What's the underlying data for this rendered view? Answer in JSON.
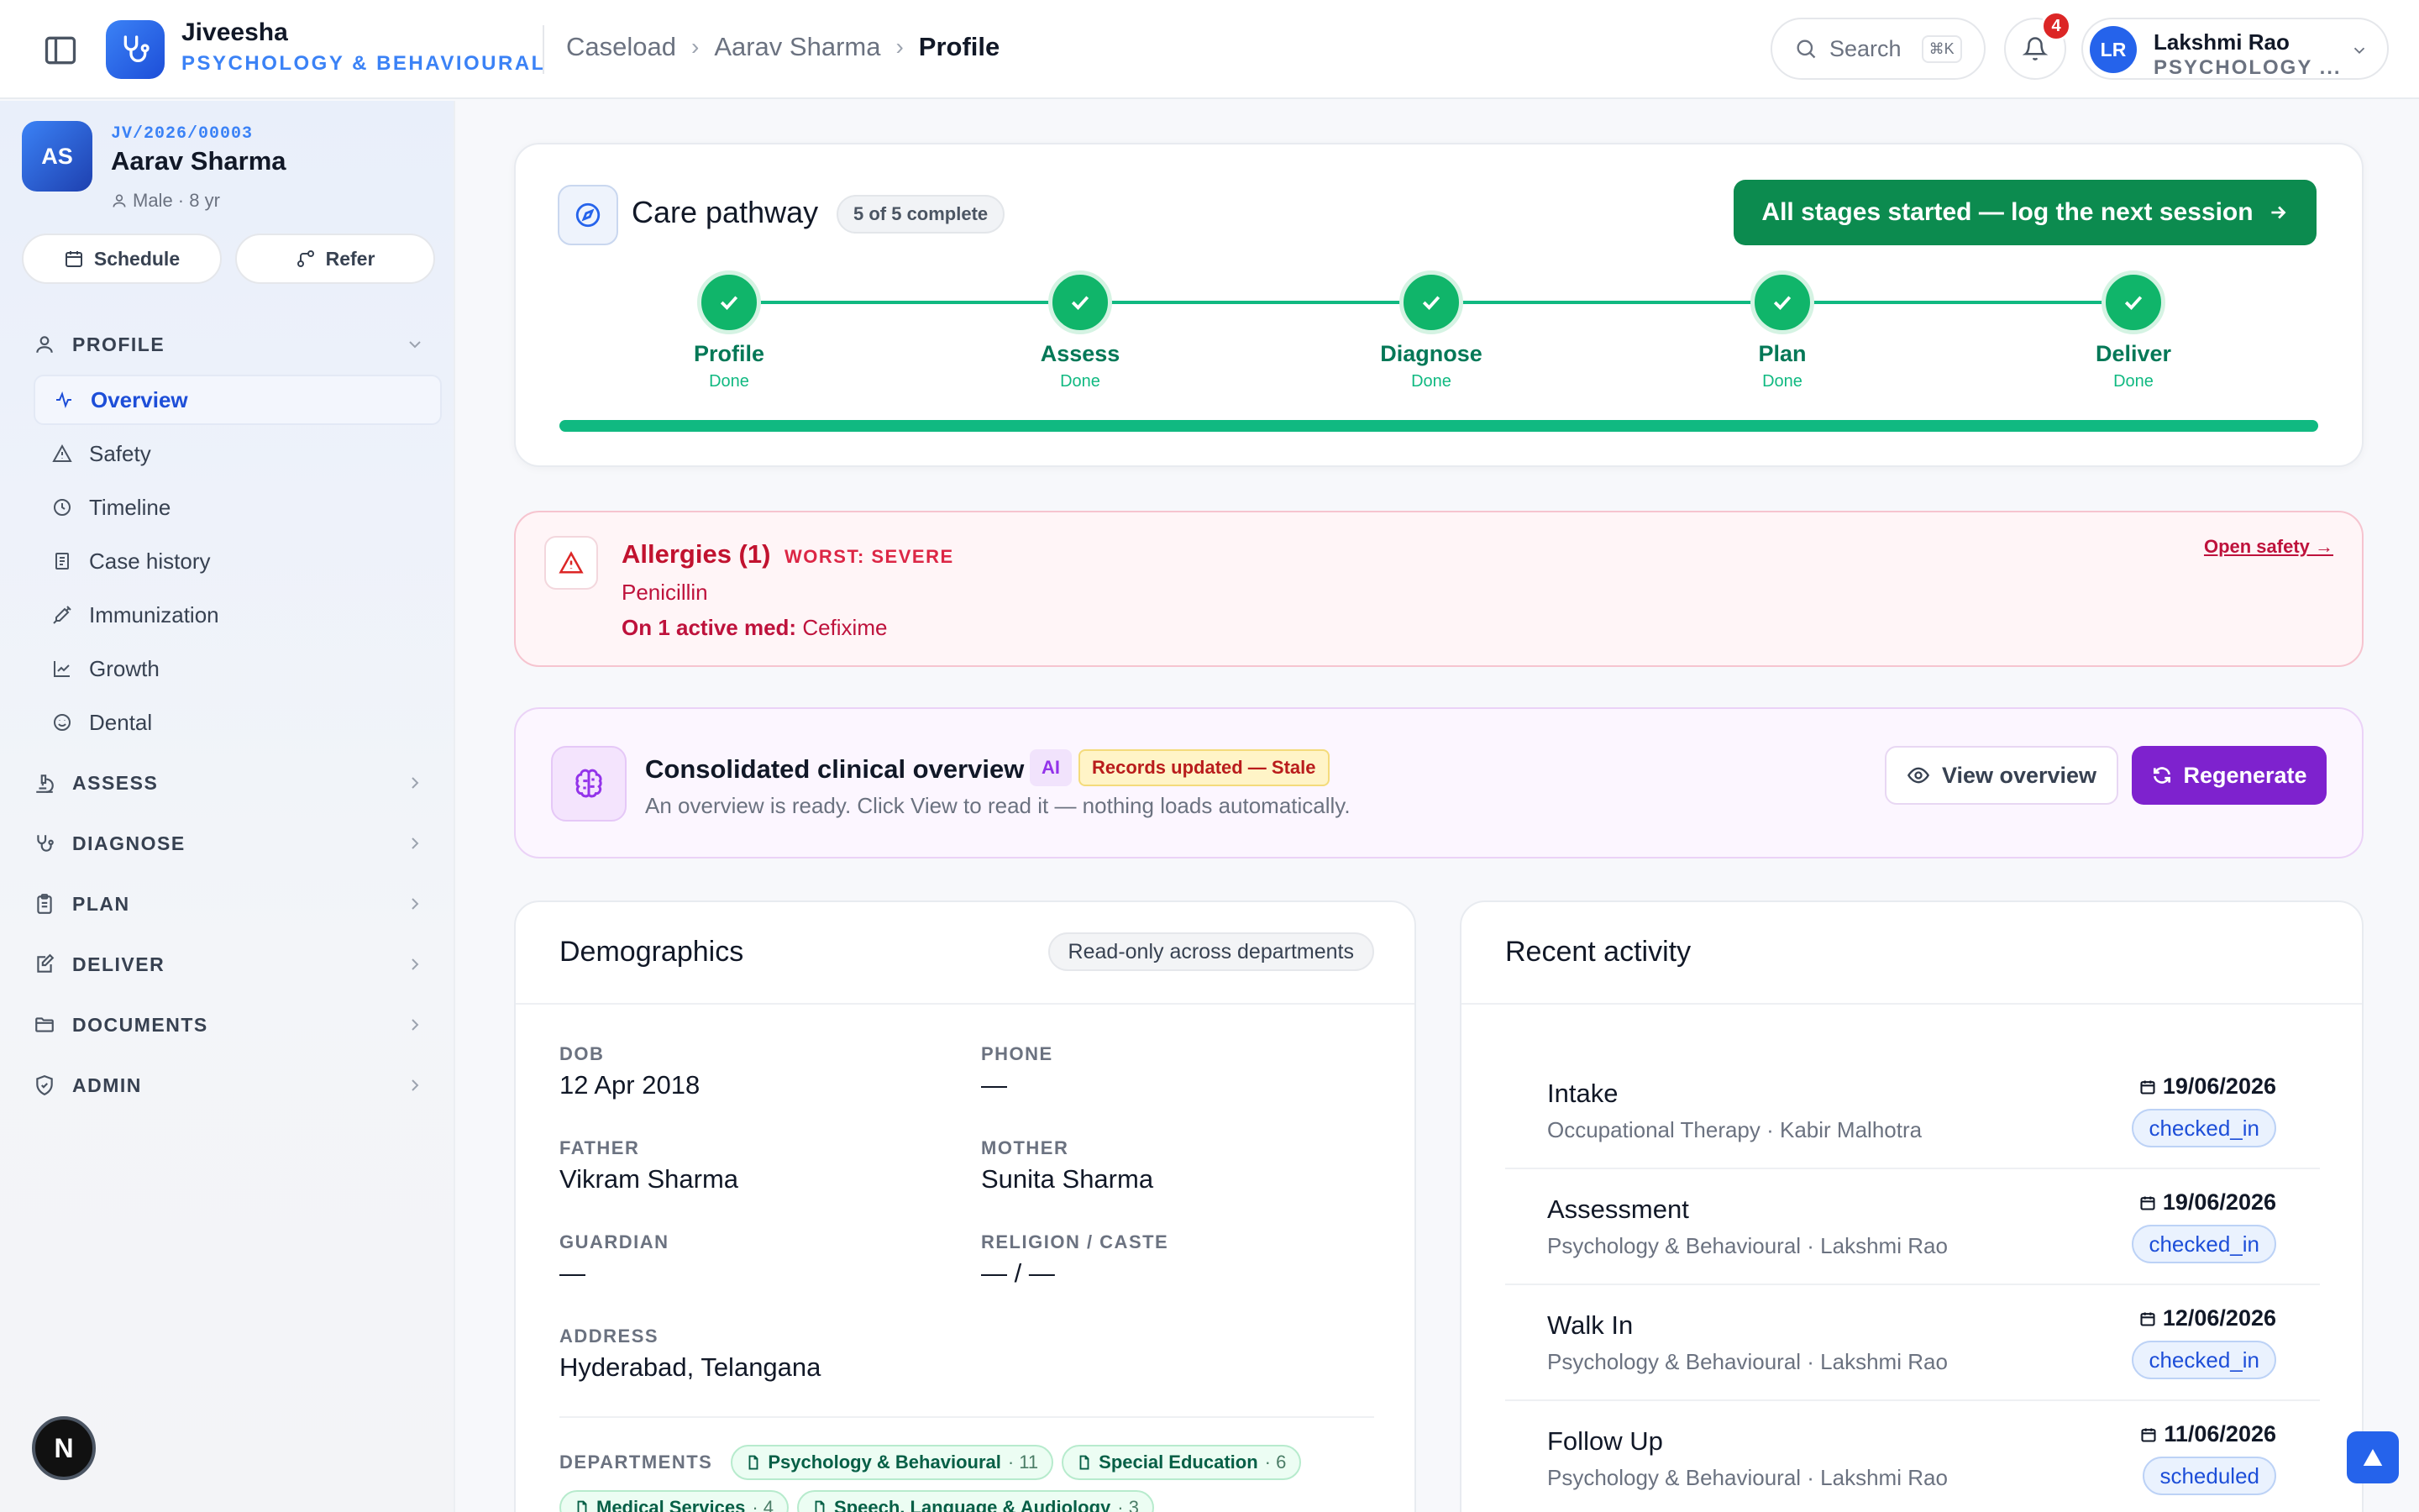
{
  "header": {
    "brand_name": "Jiveesha",
    "brand_dept": "PSYCHOLOGY & BEHAVIOURAL",
    "breadcrumb": [
      "Caseload",
      "Aarav Sharma",
      "Profile"
    ],
    "search_label": "Search",
    "search_shortcut": "⌘K",
    "notifications_count": "4",
    "user": {
      "initials": "LR",
      "name": "Lakshmi Rao",
      "dept": "PSYCHOLOGY ..."
    }
  },
  "patient": {
    "initials": "AS",
    "id": "JV/2026/00003",
    "name": "Aarav Sharma",
    "meta": "Male · 8 yr",
    "schedule_label": "Schedule",
    "refer_label": "Refer"
  },
  "sidebar": {
    "profile_label": "PROFILE",
    "profile_items": [
      {
        "label": "Overview",
        "icon": "activity-icon"
      },
      {
        "label": "Safety",
        "icon": "warning-icon"
      },
      {
        "label": "Timeline",
        "icon": "clock-icon"
      },
      {
        "label": "Case history",
        "icon": "history-icon"
      },
      {
        "label": "Immunization",
        "icon": "syringe-icon"
      },
      {
        "label": "Growth",
        "icon": "chart-icon"
      },
      {
        "label": "Dental",
        "icon": "smile-icon"
      }
    ],
    "sections": [
      "ASSESS",
      "DIAGNOSE",
      "PLAN",
      "DELIVER",
      "DOCUMENTS",
      "ADMIN"
    ]
  },
  "pathway": {
    "title": "Care pathway",
    "badge": "5 of 5 complete",
    "cta": "All stages started — log the next session",
    "progress": 1.0,
    "steps": [
      {
        "label": "Profile",
        "status": "Done"
      },
      {
        "label": "Assess",
        "status": "Done"
      },
      {
        "label": "Diagnose",
        "status": "Done"
      },
      {
        "label": "Plan",
        "status": "Done"
      },
      {
        "label": "Deliver",
        "status": "Done"
      }
    ]
  },
  "allergies": {
    "title": "Allergies (1)",
    "worst": "WORST: SEVERE",
    "item": "Penicillin",
    "med_prefix": "On 1 active med:",
    "med": "Cefixime",
    "link": "Open safety →"
  },
  "overview": {
    "title": "Consolidated clinical overview",
    "ai_tag": "AI",
    "stale_tag": "Records updated — Stale",
    "subtitle": "An overview is ready. Click View to read it — nothing loads automatically.",
    "view_label": "View overview",
    "regen_label": "Regenerate"
  },
  "demographics": {
    "title": "Demographics",
    "badge": "Read-only across departments",
    "fields": {
      "dob": {
        "label": "DOB",
        "value": "12 Apr 2018"
      },
      "phone": {
        "label": "PHONE",
        "value": "—"
      },
      "father": {
        "label": "FATHER",
        "value": "Vikram Sharma"
      },
      "mother": {
        "label": "MOTHER",
        "value": "Sunita Sharma"
      },
      "guardian": {
        "label": "GUARDIAN",
        "value": "—"
      },
      "religion": {
        "label": "RELIGION / CASTE",
        "value": "— / —"
      },
      "address": {
        "label": "ADDRESS",
        "value": "Hyderabad, Telangana"
      }
    },
    "departments_label": "DEPARTMENTS",
    "departments": [
      {
        "name": "Psychology & Behavioural",
        "count": "· 11"
      },
      {
        "name": "Special Education",
        "count": "· 6"
      },
      {
        "name": "Medical Services",
        "count": "· 4"
      },
      {
        "name": "Speech, Language & Audiology",
        "count": "· 3"
      }
    ]
  },
  "activity": {
    "title": "Recent activity",
    "items": [
      {
        "title": "Intake",
        "sub": "Occupational Therapy · Kabir Malhotra",
        "date": "19/06/2026",
        "status": "checked_in"
      },
      {
        "title": "Assessment",
        "sub": "Psychology & Behavioural · Lakshmi Rao",
        "date": "19/06/2026",
        "status": "checked_in"
      },
      {
        "title": "Walk In",
        "sub": "Psychology & Behavioural · Lakshmi Rao",
        "date": "12/06/2026",
        "status": "checked_in"
      },
      {
        "title": "Follow Up",
        "sub": "Psychology & Behavioural · Lakshmi Rao",
        "date": "11/06/2026",
        "status": "scheduled"
      }
    ]
  },
  "misc": {
    "dev_badge": "N"
  }
}
